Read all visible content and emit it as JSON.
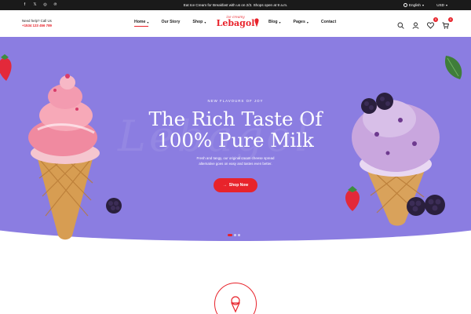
{
  "topbar": {
    "socials": [
      "facebook-icon",
      "x-icon",
      "instagram-icon",
      "pinterest-icon"
    ],
    "announcement": "Eat Ice Cream for Breakfast with us on 2/3. Shops open at 9 a.m.",
    "language": "English",
    "currency": "USD"
  },
  "header": {
    "help_label": "Need help? Call Us",
    "phone": "+1534 123 456 789",
    "logo_tagline": "ice creamy",
    "logo_name": "Lebagol",
    "nav_left": [
      {
        "label": "Home",
        "dropdown": true,
        "active": true
      },
      {
        "label": "Our Story",
        "dropdown": false
      },
      {
        "label": "Shop",
        "dropdown": true
      }
    ],
    "nav_right": [
      {
        "label": "Blog",
        "dropdown": true
      },
      {
        "label": "Pages",
        "dropdown": true
      },
      {
        "label": "Contact",
        "dropdown": false
      }
    ],
    "wishlist_count": "0",
    "cart_count": "0"
  },
  "hero": {
    "eyebrow": "NEW FLAVOURS OF JOY",
    "title_line1": "The Rich Taste Of",
    "title_line2": "100% Pure Milk",
    "description": "Fresh and tangy, our original cream cheese spread alternative goes on easy and tastes even better.",
    "cta_label": "Shop Now",
    "slides": 3,
    "active_slide": 1
  },
  "colors": {
    "accent": "#e8232b",
    "hero_bg": "#8b7de1",
    "topbar_bg": "#1a1a1a"
  }
}
